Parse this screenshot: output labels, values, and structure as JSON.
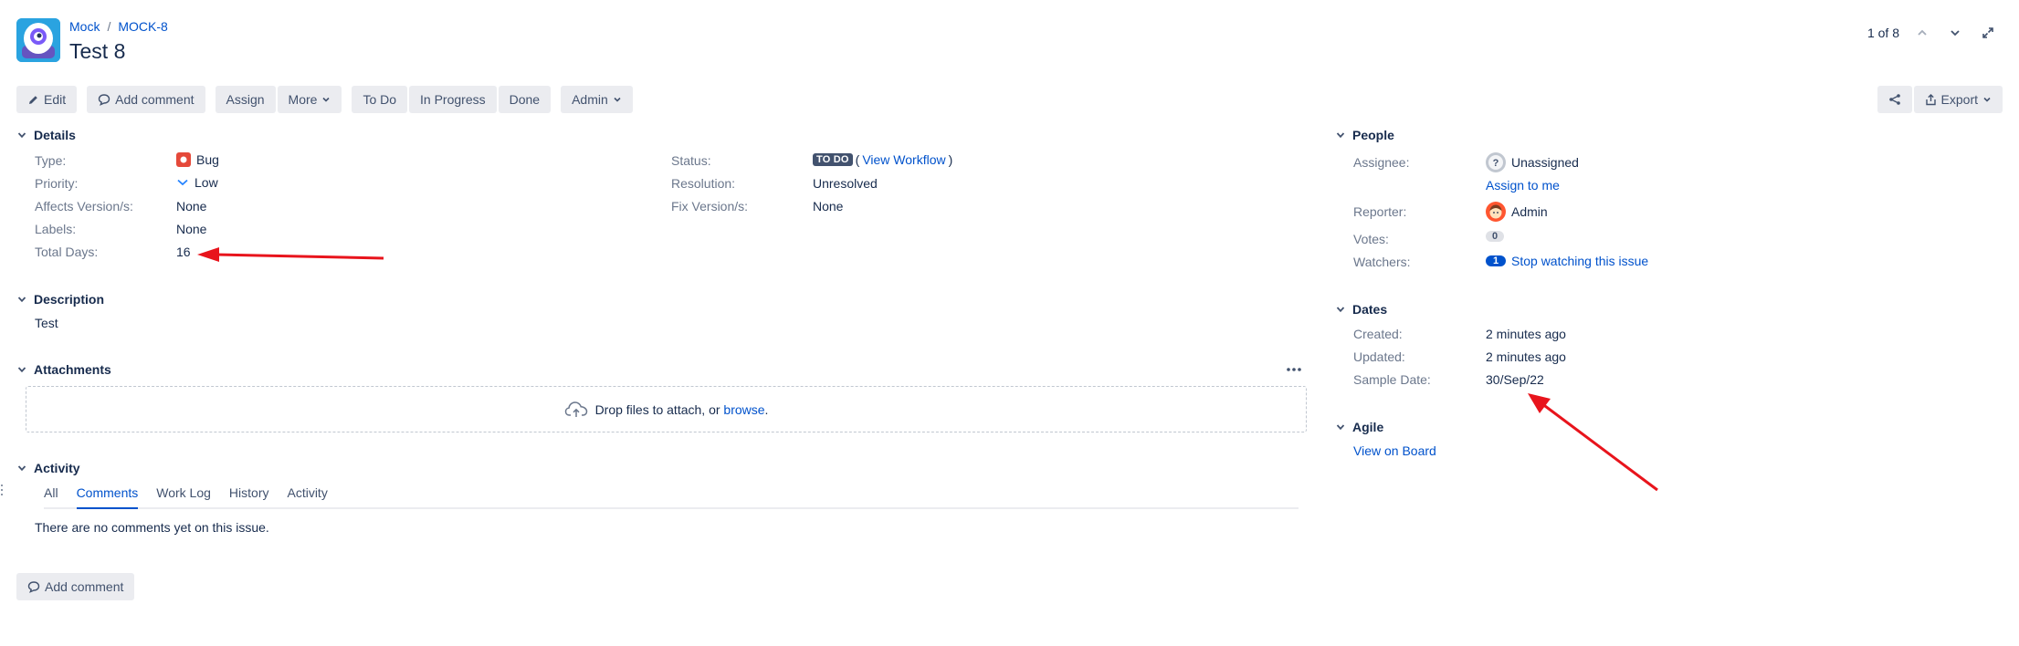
{
  "header": {
    "breadcrumb": {
      "project": "Mock",
      "sep": "/",
      "issue_key": "MOCK-8"
    },
    "title": "Test 8",
    "pager": "1 of 8"
  },
  "toolbar": {
    "edit": "Edit",
    "add_comment": "Add comment",
    "assign": "Assign",
    "more": "More",
    "todo": "To Do",
    "in_progress": "In Progress",
    "done": "Done",
    "admin": "Admin",
    "export": "Export"
  },
  "details": {
    "heading": "Details",
    "left": [
      {
        "label": "Type:",
        "value": "Bug"
      },
      {
        "label": "Priority:",
        "value": "Low"
      },
      {
        "label": "Affects Version/s:",
        "value": "None"
      },
      {
        "label": "Labels:",
        "value": "None"
      },
      {
        "label": "Total Days:",
        "value": "16"
      }
    ],
    "status_label": "Status:",
    "status_lozenge": "TO DO",
    "status_link_open": "(",
    "status_link": "View Workflow",
    "status_link_close": ")",
    "resolution_label": "Resolution:",
    "resolution_value": "Unresolved",
    "fix_label": "Fix Version/s:",
    "fix_value": "None"
  },
  "description": {
    "heading": "Description",
    "text": "Test"
  },
  "attachments": {
    "heading": "Attachments",
    "drop_text": "Drop files to attach, or",
    "browse": "browse",
    "period": "."
  },
  "activity": {
    "heading": "Activity",
    "tabs": [
      "All",
      "Comments",
      "Work Log",
      "History",
      "Activity"
    ],
    "active_tab": "Comments",
    "empty_text": "There are no comments yet on this issue.",
    "add_comment": "Add comment"
  },
  "people": {
    "heading": "People",
    "assignee_label": "Assignee:",
    "assignee_value": "Unassigned",
    "assign_to_me": "Assign to me",
    "reporter_label": "Reporter:",
    "reporter_value": "Admin",
    "votes_label": "Votes:",
    "votes_count": "0",
    "watchers_label": "Watchers:",
    "watchers_count": "1",
    "watchers_link": "Stop watching this issue"
  },
  "dates": {
    "heading": "Dates",
    "created_label": "Created:",
    "created_value": "2 minutes ago",
    "updated_label": "Updated:",
    "updated_value": "2 minutes ago",
    "sample_label": "Sample Date:",
    "sample_value": "30/Sep/22"
  },
  "agile": {
    "heading": "Agile",
    "link": "View on Board"
  },
  "colors": {
    "link": "#0052cc",
    "button_bg": "#ebecf0",
    "annotation_arrow": "#e8141c",
    "bug": "#e5493a"
  }
}
